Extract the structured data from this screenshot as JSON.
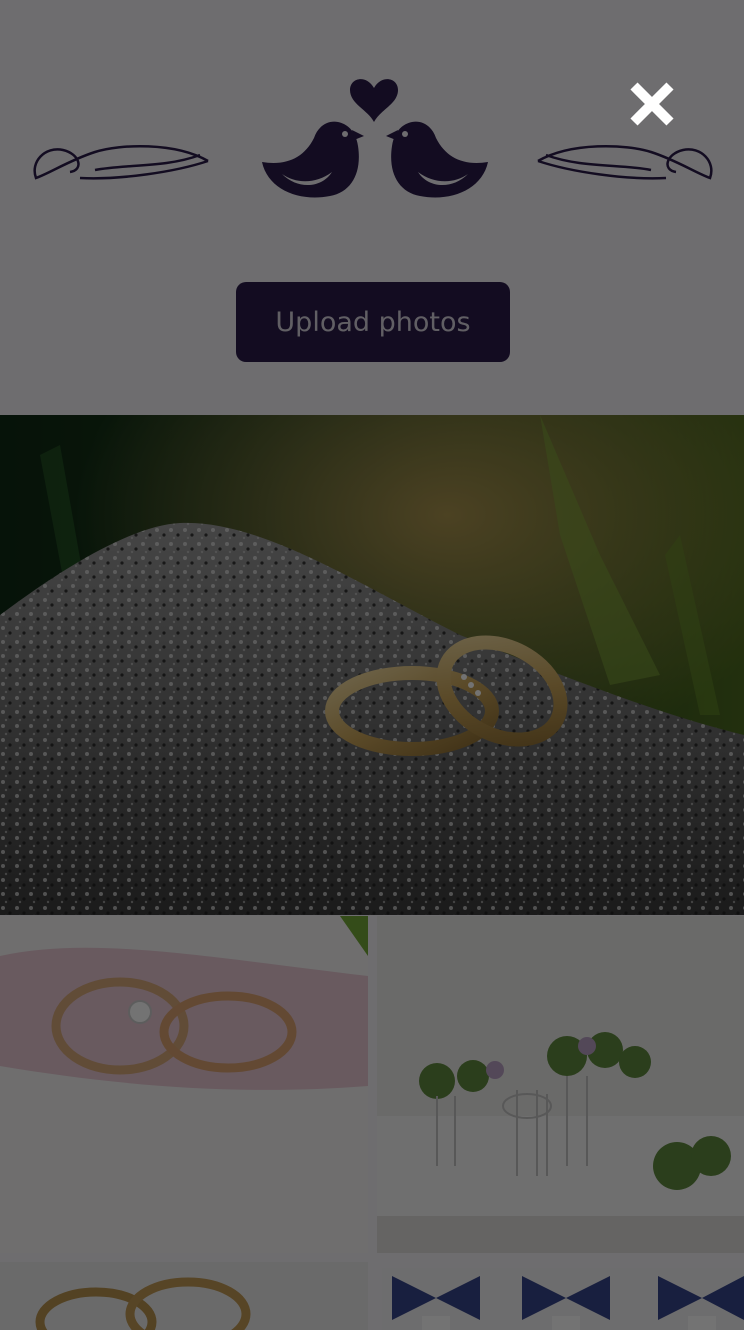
{
  "header": {
    "ornament_icon": "love-birds-icon",
    "upload_button_label": "Upload photos",
    "brand_color": "#2a1b4b"
  },
  "gallery": {
    "photos": [
      {
        "icon": "wedding-rings-on-rock-photo"
      },
      {
        "icon": "rings-with-diamond-photo"
      },
      {
        "icon": "table-setting-photo"
      },
      {
        "icon": "rings-on-letter-photo"
      },
      {
        "icon": "blue-bow-chairs-photo"
      }
    ]
  },
  "modal": {
    "close_icon": "close-icon",
    "overlay_color": "rgba(0,0,0,0.55)"
  }
}
